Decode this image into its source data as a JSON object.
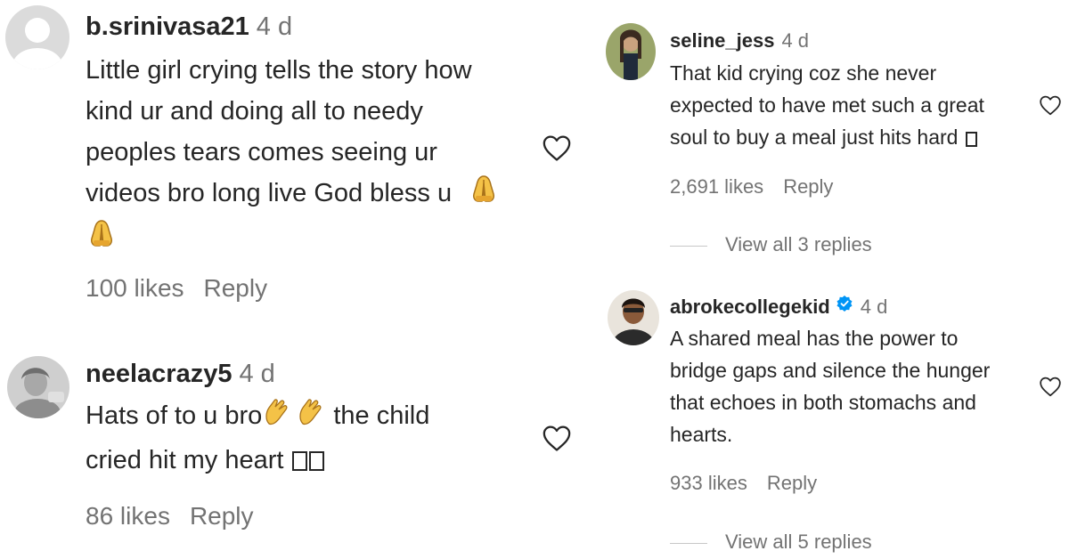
{
  "comments_left": [
    {
      "username": "b.srinivasa21",
      "time": "4 d",
      "text_line1": "Little girl crying tells the story how",
      "text_line2": "kind ur and doing all to needy",
      "text_line3": "peoples tears comes seeing ur",
      "text_line4": "videos bro long live God bless u",
      "likes": "100 likes",
      "reply": "Reply"
    },
    {
      "username": "neelacrazy5",
      "time": "4 d",
      "text_line1a": "Hats of to u bro",
      "text_line1b": " the child",
      "text_line2": "cried hit my heart ",
      "likes": "86 likes",
      "reply": "Reply"
    }
  ],
  "comments_right": [
    {
      "username": "seline_jess",
      "time": "4 d",
      "text_line1": "That kid crying coz she never",
      "text_line2": "expected to have met such a great",
      "text_line3": "soul to buy a meal just hits hard ",
      "likes": "2,691 likes",
      "reply": "Reply",
      "view_replies": "View all 3 replies"
    },
    {
      "username": "abrokecollegekid",
      "time": "4 d",
      "text_line1": "A shared meal has the power to",
      "text_line2": "bridge gaps and silence the hunger",
      "text_line3": "that echoes in both stomachs and",
      "text_line4": "hearts.",
      "likes": "933 likes",
      "reply": "Reply",
      "view_replies": "View all 5 replies"
    }
  ],
  "icons": {
    "like": "heart-icon",
    "verified": "verified-badge-icon",
    "pray": "folded-hands-emoji",
    "clap": "clapping-hands-emoji"
  },
  "colors": {
    "text": "#262626",
    "muted": "#737373",
    "verified": "#0095f6",
    "divider": "#c7c7c7"
  }
}
